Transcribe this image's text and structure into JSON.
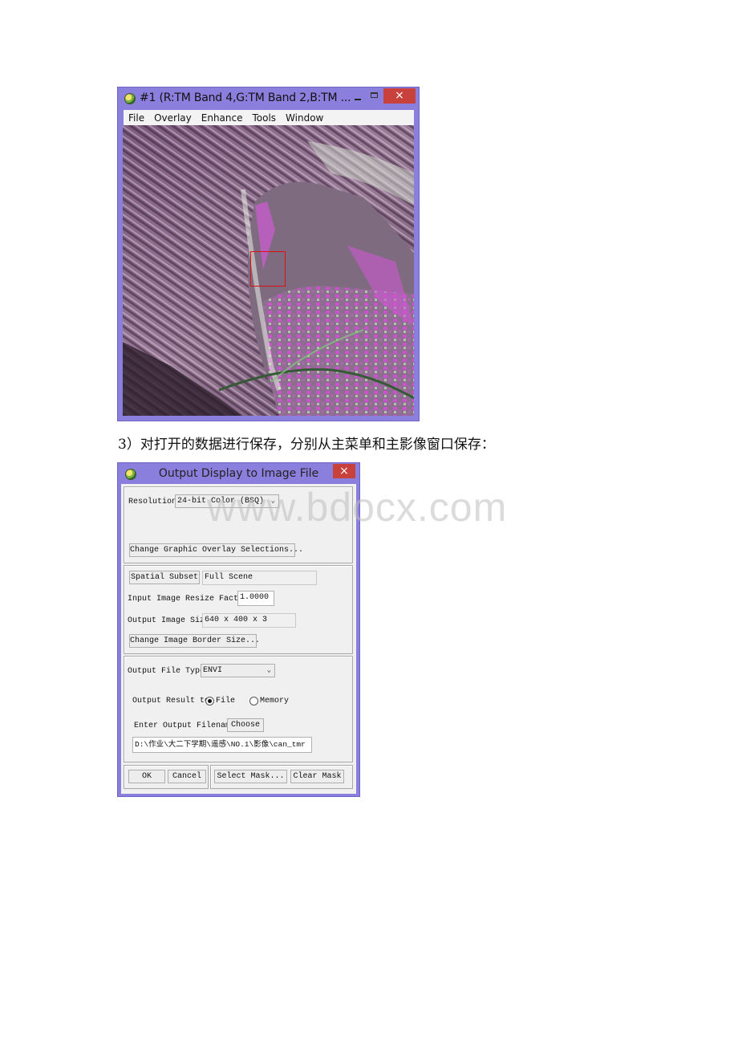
{
  "display_window": {
    "title": "#1 (R:TM Band 4,G:TM Band 2,B:TM ...",
    "controls": {
      "minimize": "–",
      "maximize": "□",
      "close": "×"
    },
    "menu": [
      "File",
      "Overlay",
      "Enhance",
      "Tools",
      "Window"
    ],
    "image_description": "False-color TM satellite image (R:Band 4, G:Band 2, B:Band 3) with red zoom-box indicator",
    "colors": {
      "window_frame": "#8a7fdc",
      "close_button": "#c9413c",
      "zoom_box": "#e01010"
    }
  },
  "caption": "3）对打开的数据进行保存，分别从主菜单和主影像窗口保存：",
  "output_dialog": {
    "title": "Output Display to Image File",
    "close_label": "×",
    "resolution": {
      "label": "Resolution",
      "value": "24-bit Color (BSQ)"
    },
    "change_overlay_button": "Change Graphic Overlay Selections...",
    "spatial_subset_button": "Spatial Subset",
    "spatial_subset_value": "Full Scene",
    "resize_factor": {
      "label": "Input Image Resize Factor",
      "value": "1.0000"
    },
    "output_size": {
      "label": "Output Image Size",
      "value": "640 x 400 x 3"
    },
    "change_border_button": "Change Image Border Size...",
    "file_type": {
      "label": "Output File Type",
      "value": "ENVI"
    },
    "output_result": {
      "label": "Output Result to",
      "options": [
        "File",
        "Memory"
      ],
      "selected": "File"
    },
    "filename": {
      "label": "Enter Output Filename",
      "choose_button": "Choose",
      "value": "D:\\作业\\大二下学期\\遥感\\NO.1\\影像\\can_tmr"
    },
    "buttons": {
      "ok": "OK",
      "cancel": "Cancel",
      "select_mask": "Select Mask...",
      "clear_mask": "Clear Mask"
    }
  },
  "watermark": "www.bdocx.com"
}
